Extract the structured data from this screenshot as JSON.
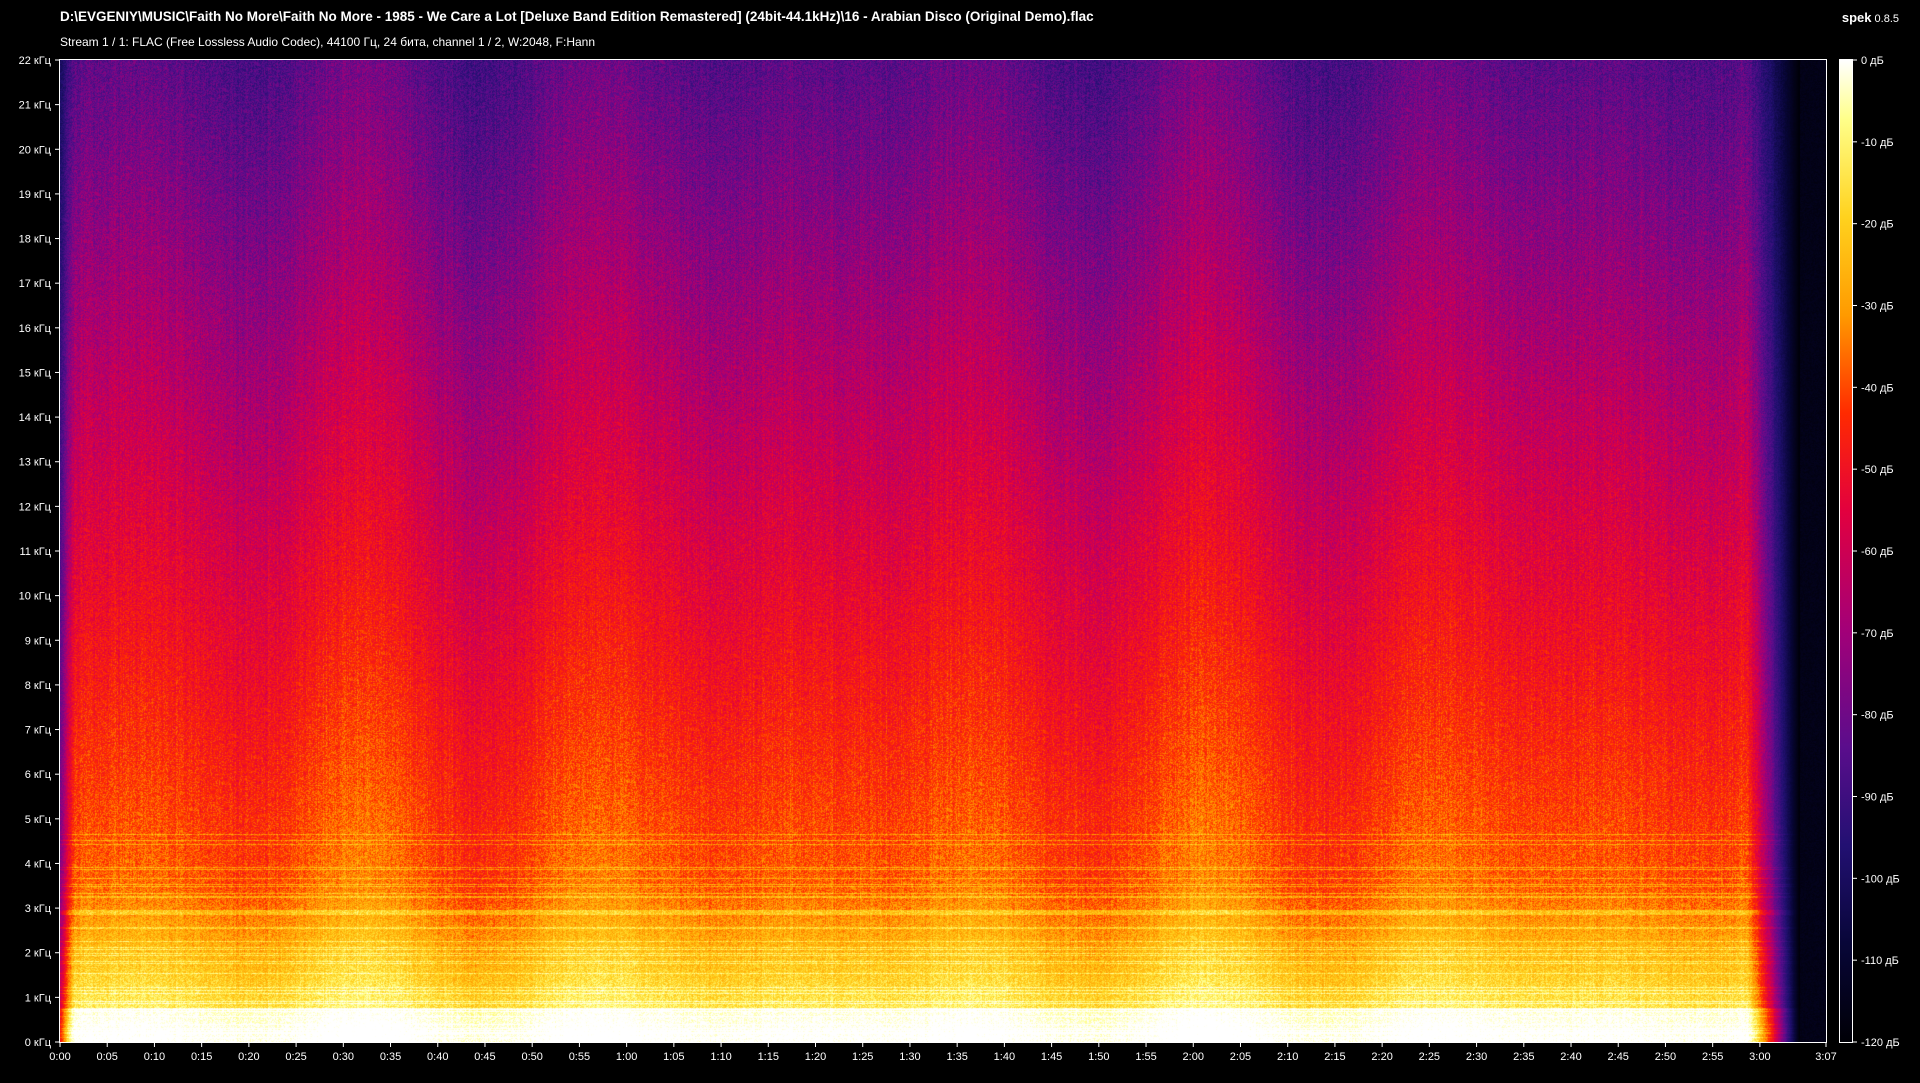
{
  "window": {
    "file_title": "D:\\EVGENIY\\MUSIC\\Faith No More\\Faith No More - 1985 - We Care a Lot [Deluxe Band Edition Remastered] (24bit-44.1kHz)\\16 - Arabian Disco (Original Demo).flac",
    "stream_info": "Stream 1 / 1: FLAC (Free Lossless Audio Codec), 44100 Гц, 24 бита, channel 1 / 2, W:2048, F:Hann",
    "app_name": "spek",
    "app_version": "0.8.5"
  },
  "colors": {
    "background": "#000000",
    "text": "#ffffff",
    "palette": [
      "#000006",
      "#080638",
      "#221072",
      "#5a0d8c",
      "#a30078",
      "#e2003f",
      "#ff2a00",
      "#ff9a00",
      "#ffd21e",
      "#ffff8a",
      "#ffffff"
    ]
  },
  "chart_data": {
    "type": "heatmap",
    "x": {
      "range": [
        0,
        187
      ],
      "ticks": [
        0,
        5,
        10,
        15,
        20,
        25,
        30,
        35,
        40,
        45,
        50,
        55,
        60,
        65,
        70,
        75,
        80,
        85,
        90,
        95,
        100,
        105,
        110,
        115,
        120,
        125,
        130,
        135,
        140,
        145,
        150,
        155,
        160,
        165,
        170,
        175,
        180,
        187
      ],
      "tick_labels": [
        "0:00",
        "0:05",
        "0:10",
        "0:15",
        "0:20",
        "0:25",
        "0:30",
        "0:35",
        "0:40",
        "0:45",
        "0:50",
        "0:55",
        "1:00",
        "1:05",
        "1:10",
        "1:15",
        "1:20",
        "1:25",
        "1:30",
        "1:35",
        "1:40",
        "1:45",
        "1:50",
        "1:55",
        "2:00",
        "2:05",
        "2:10",
        "2:15",
        "2:20",
        "2:25",
        "2:30",
        "2:35",
        "2:40",
        "2:45",
        "2:50",
        "2:55",
        "3:00",
        "3:07"
      ]
    },
    "y": {
      "range": [
        0,
        22
      ],
      "ticks": [
        0,
        1,
        2,
        3,
        4,
        5,
        6,
        7,
        8,
        9,
        10,
        11,
        12,
        13,
        14,
        15,
        16,
        17,
        18,
        19,
        20,
        21,
        22
      ],
      "tick_labels": [
        "0 кГц",
        "1 кГц",
        "2 кГц",
        "3 кГц",
        "4 кГц",
        "5 кГц",
        "6 кГц",
        "7 кГц",
        "8 кГц",
        "9 кГц",
        "10 кГц",
        "11 кГц",
        "12 кГц",
        "13 кГц",
        "14 кГц",
        "15 кГц",
        "16 кГц",
        "17 кГц",
        "18 кГц",
        "19 кГц",
        "20 кГц",
        "21 кГц",
        "22 кГц"
      ]
    },
    "colorbar": {
      "range": [
        -120,
        0
      ],
      "ticks": [
        0,
        -10,
        -20,
        -30,
        -40,
        -50,
        -60,
        -70,
        -80,
        -90,
        -100,
        -110,
        -120
      ],
      "tick_labels": [
        "0 дБ",
        "-10 дБ",
        "-20 дБ",
        "-30 дБ",
        "-40 дБ",
        "-50 дБ",
        "-60 дБ",
        "-70 дБ",
        "-80 дБ",
        "-90 дБ",
        "-100 дБ",
        "-110 дБ",
        "-120 дБ"
      ]
    }
  }
}
